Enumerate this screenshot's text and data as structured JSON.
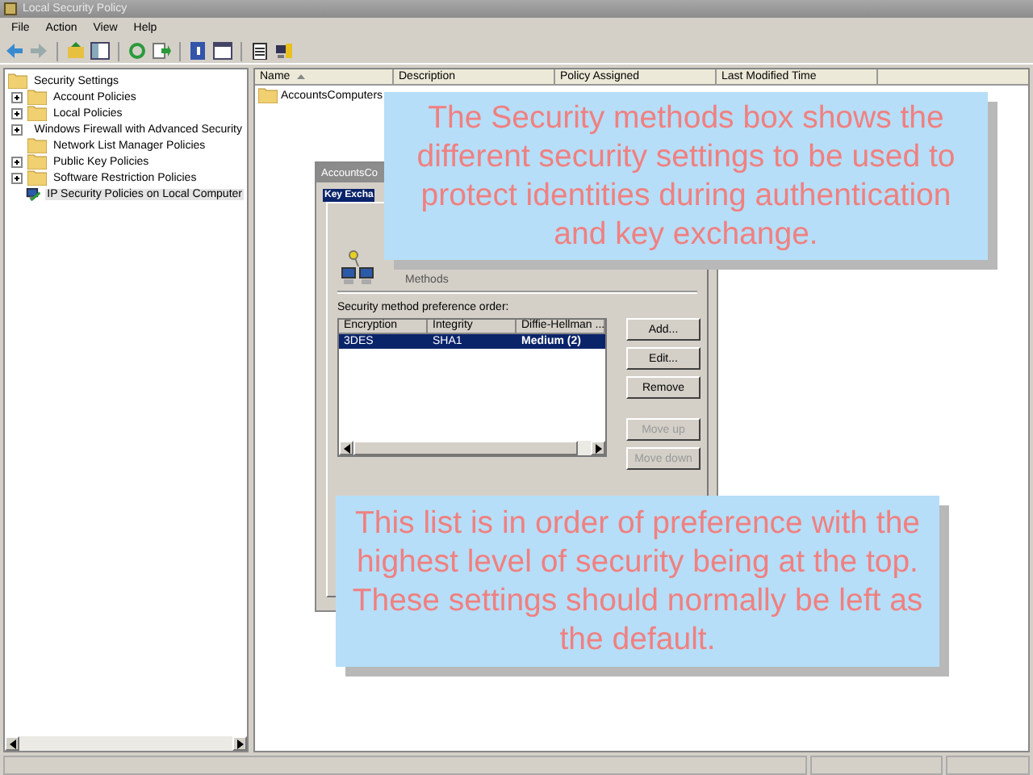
{
  "window": {
    "title": "Local Security Policy"
  },
  "menu": [
    "File",
    "Action",
    "View",
    "Help"
  ],
  "tree": {
    "label": "Security Settings",
    "children": [
      {
        "label": "Account Policies",
        "expandable": true,
        "selected": false
      },
      {
        "label": "Local Policies",
        "expandable": true,
        "selected": false
      },
      {
        "label": "Windows Firewall with Advanced Security",
        "expandable": true,
        "selected": false
      },
      {
        "label": "Network List Manager Policies",
        "expandable": false,
        "selected": false
      },
      {
        "label": "Public Key Policies",
        "expandable": true,
        "selected": false
      },
      {
        "label": "Software Restriction Policies",
        "expandable": true,
        "selected": false
      },
      {
        "label": "IP Security Policies on Local Computer",
        "expandable": false,
        "selected": true
      }
    ]
  },
  "list": {
    "columns": [
      {
        "label": "Name",
        "sorted": true
      },
      {
        "label": "Description",
        "sorted": false
      },
      {
        "label": "Policy Assigned",
        "sorted": false
      },
      {
        "label": "Last Modified Time",
        "sorted": false
      }
    ],
    "rows": [
      {
        "name": "AccountsComputers"
      }
    ]
  },
  "dialog": {
    "title": "AccountsCo",
    "tab": "Key Excha",
    "methods_text": "Methods",
    "group_label": "Security method preference order:",
    "columns": [
      "Encryption",
      "Integrity",
      "Diffie-Hellman ..."
    ],
    "rows": [
      {
        "cells": [
          "3DES",
          "SHA1",
          "Medium (2)"
        ],
        "selected": true
      }
    ],
    "buttons": [
      {
        "label": "Add...",
        "disabled": false
      },
      {
        "label": "Edit...",
        "disabled": false
      },
      {
        "label": "Remove",
        "disabled": false
      },
      {
        "label": "Move up",
        "disabled": true
      },
      {
        "label": "Move down",
        "disabled": true
      }
    ]
  },
  "callouts": [
    "The Security methods box shows the different security settings to be used to protect identities during authentication and key exchange.",
    "This list is in order of preference with the highest level of security being at the top. These settings should normally be left as the default."
  ]
}
